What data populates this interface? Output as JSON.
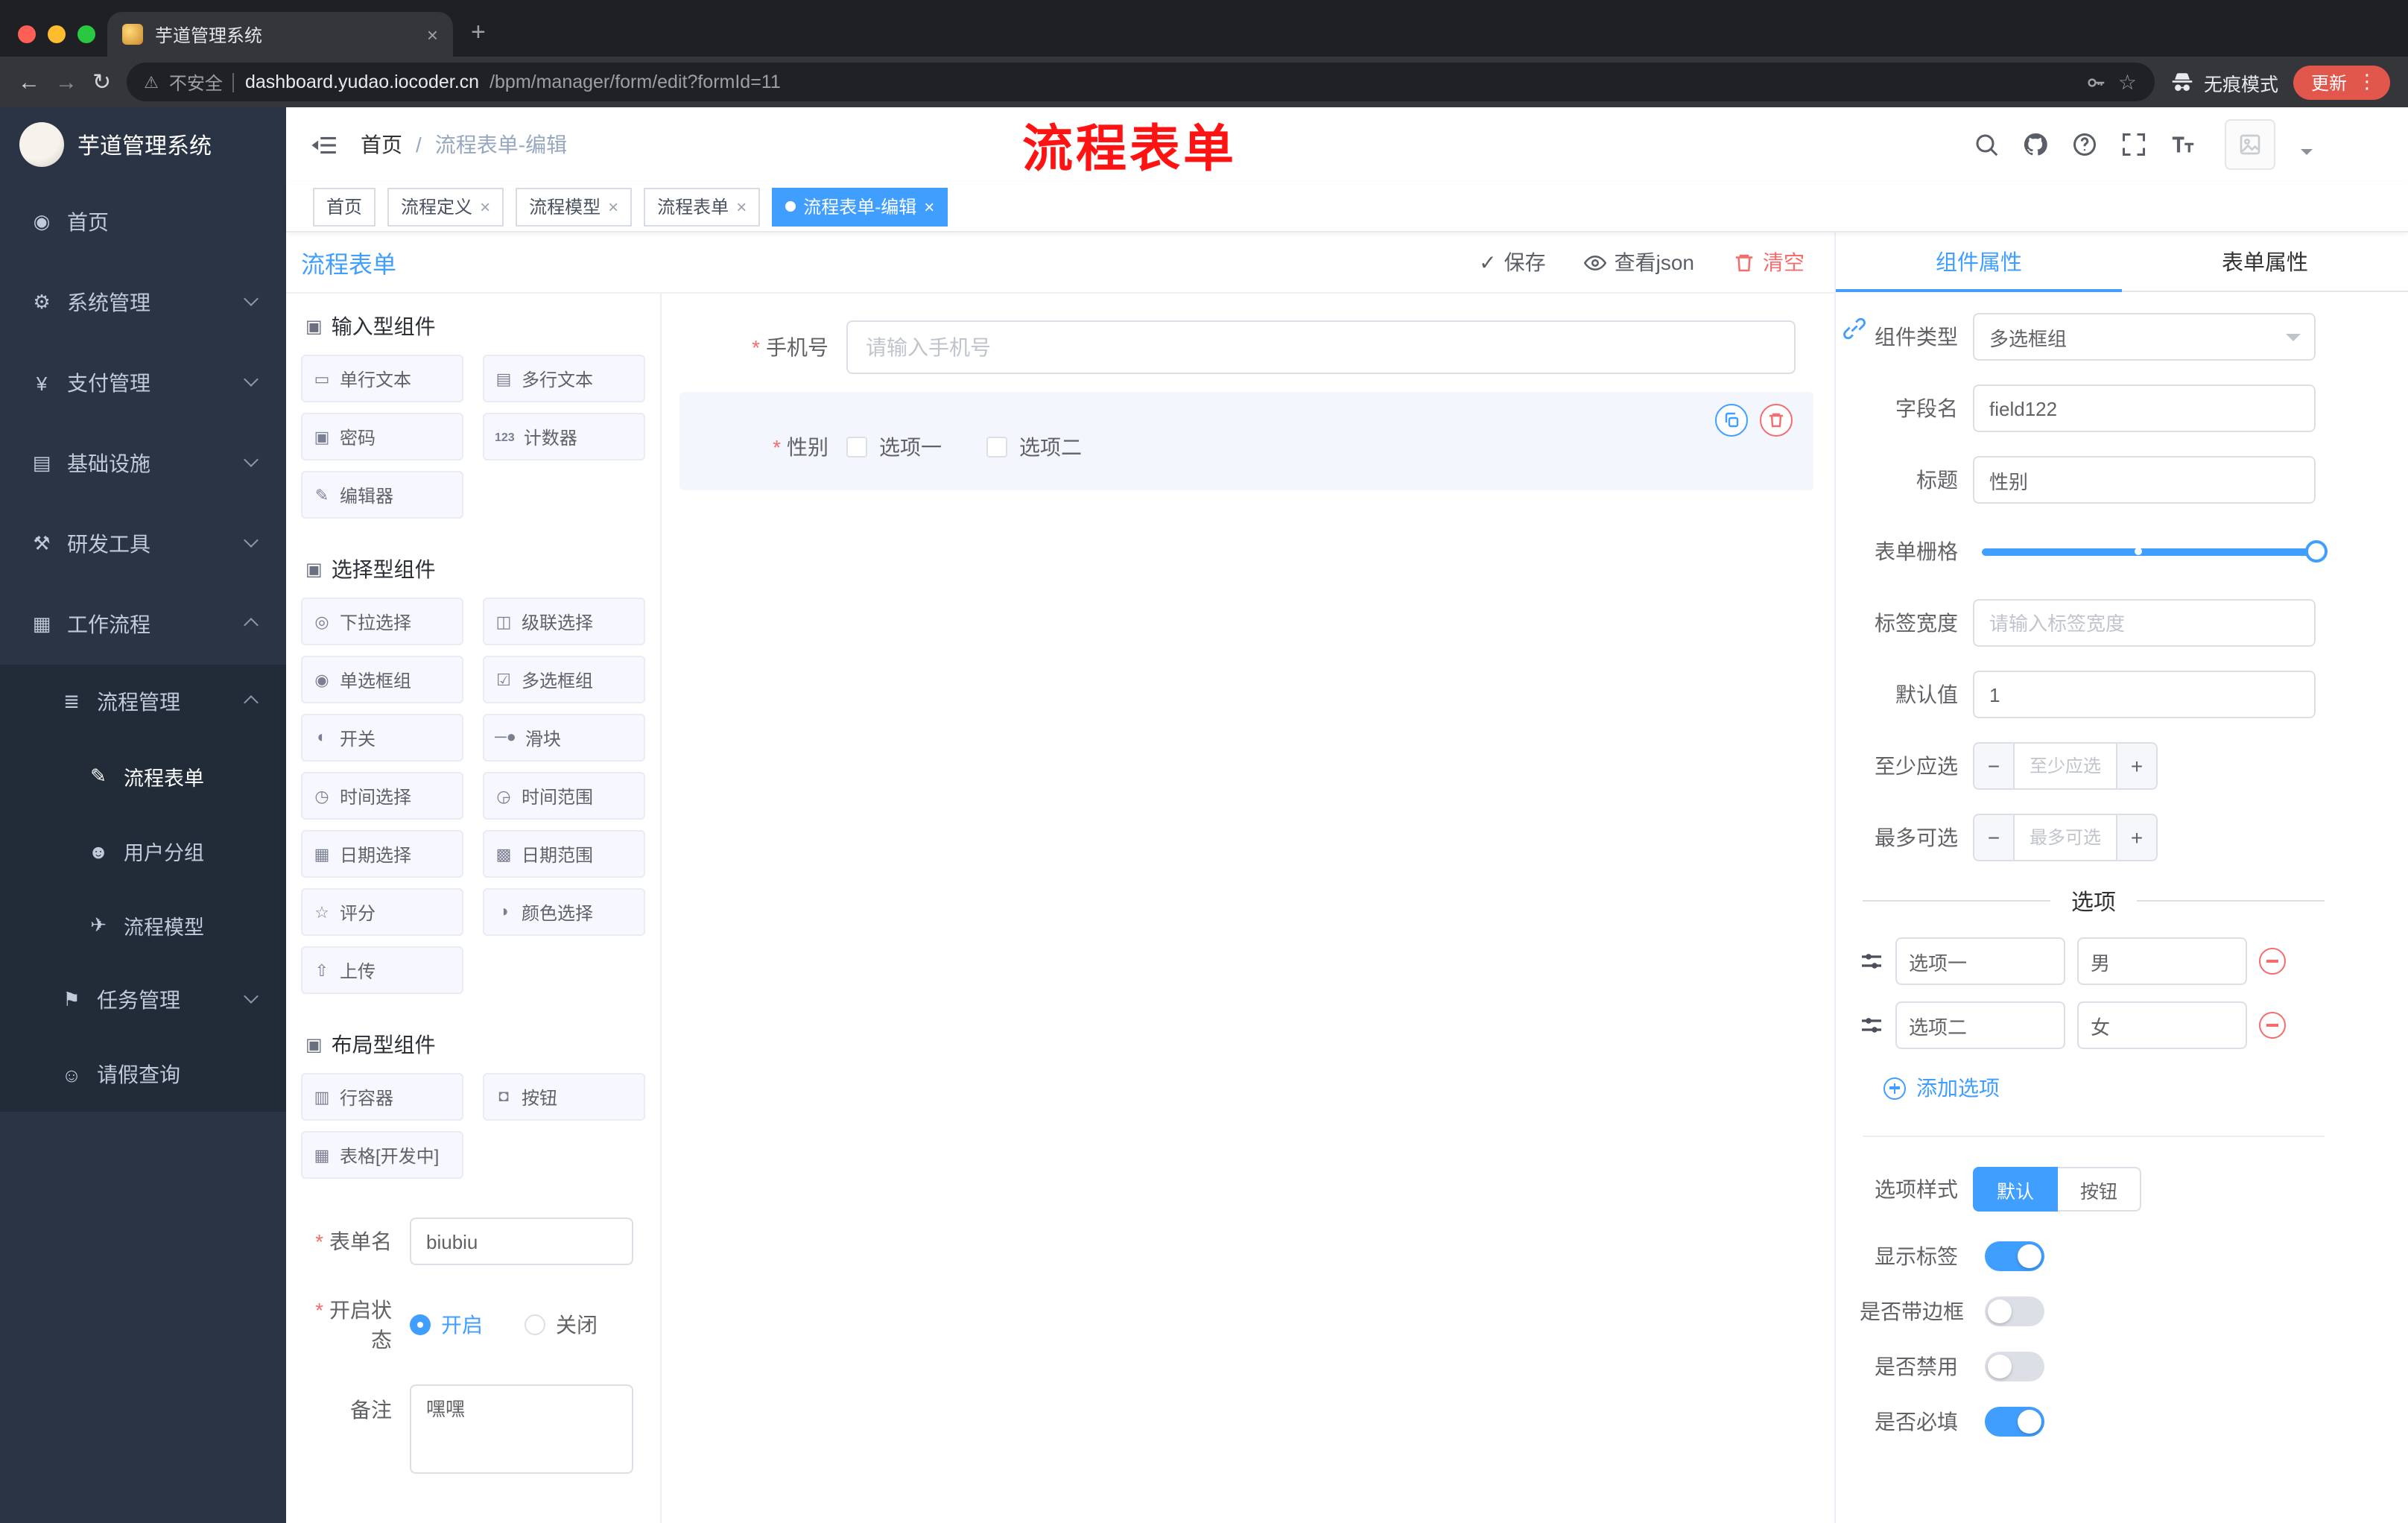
{
  "browser": {
    "tab_title": "芋道管理系统",
    "security_text": "不安全",
    "url_host": "dashboard.yudao.iocoder.cn",
    "url_path": "/bpm/manager/form/edit?formId=11",
    "incognito_label": "无痕模式",
    "update_label": "更新"
  },
  "icons": {
    "close": "×",
    "plus": "+",
    "back": "←",
    "forward": "→",
    "reload": "↻",
    "dots": "⋮",
    "warning": "⚠",
    "star": "☆",
    "check": "✓",
    "minus": "−",
    "plus_small": "+",
    "section": "▣"
  },
  "sidebar": {
    "logo_title": "芋道管理系统",
    "items": [
      {
        "icon": "◉",
        "label": "首页"
      },
      {
        "icon": "⚙",
        "label": "系统管理"
      },
      {
        "icon": "¥",
        "label": "支付管理"
      },
      {
        "icon": "▤",
        "label": "基础设施"
      },
      {
        "icon": "⚒",
        "label": "研发工具"
      },
      {
        "icon": "▦",
        "label": "工作流程"
      },
      {
        "icon": "≣",
        "label": "流程管理"
      },
      {
        "icon": "✎",
        "label": "流程表单"
      },
      {
        "icon": "☻",
        "label": "用户分组"
      },
      {
        "icon": "✈",
        "label": "流程模型"
      },
      {
        "icon": "⚑",
        "label": "任务管理"
      },
      {
        "icon": "☺",
        "label": "请假查询"
      }
    ]
  },
  "header": {
    "breadcrumb_home": "首页",
    "breadcrumb_sep": "/",
    "breadcrumb_current": "流程表单-编辑",
    "annotation": "流程表单"
  },
  "tags": {
    "items": [
      {
        "label": "首页"
      },
      {
        "label": "流程定义"
      },
      {
        "label": "流程模型"
      },
      {
        "label": "流程表单"
      },
      {
        "label": "流程表单-编辑"
      }
    ]
  },
  "designer": {
    "title": "流程表单",
    "actions": {
      "save": "保存",
      "view_json": "查看json",
      "clear": "清空"
    },
    "sections": [
      {
        "title": "输入型组件",
        "items": [
          {
            "icon": "▭",
            "label": "单行文本"
          },
          {
            "icon": "▤",
            "label": "多行文本"
          },
          {
            "icon": "▣",
            "label": "密码"
          },
          {
            "icon": "123",
            "label": "计数器"
          },
          {
            "icon": "✎",
            "label": "编辑器"
          }
        ]
      },
      {
        "title": "选择型组件",
        "items": [
          {
            "icon": "◎",
            "label": "下拉选择"
          },
          {
            "icon": "◫",
            "label": "级联选择"
          },
          {
            "icon": "◉",
            "label": "单选框组"
          },
          {
            "icon": "☑",
            "label": "多选框组"
          },
          {
            "icon": "◐",
            "label": "开关"
          },
          {
            "icon": "─●",
            "label": "滑块"
          },
          {
            "icon": "◷",
            "label": "时间选择"
          },
          {
            "icon": "◶",
            "label": "时间范围"
          },
          {
            "icon": "▦",
            "label": "日期选择"
          },
          {
            "icon": "▩",
            "label": "日期范围"
          },
          {
            "icon": "☆",
            "label": "评分"
          },
          {
            "icon": "◑",
            "label": "颜色选择"
          },
          {
            "icon": "⇧",
            "label": "上传"
          }
        ]
      },
      {
        "title": "布局型组件",
        "items": [
          {
            "icon": "▥",
            "label": "行容器"
          },
          {
            "icon": "◘",
            "label": "按钮"
          },
          {
            "icon": "▦",
            "label": "表格[开发中]"
          }
        ]
      }
    ],
    "meta": {
      "form_name_label": "表单名",
      "form_name_value": "biubiu",
      "status_label": "开启状态",
      "status_on": "开启",
      "status_off": "关闭",
      "remark_label": "备注",
      "remark_value": "嘿嘿"
    }
  },
  "canvas": {
    "phone_label": "手机号",
    "phone_placeholder": "请输入手机号",
    "gender_label": "性别",
    "gender_options": [
      "选项一",
      "选项二"
    ]
  },
  "props": {
    "tabs": [
      "组件属性",
      "表单属性"
    ],
    "rows": {
      "type_label": "组件类型",
      "type_value": "多选框组",
      "field_label": "字段名",
      "field_value": "field122",
      "title_label": "标题",
      "title_value": "性别",
      "grid_label": "表单栅格",
      "width_label": "标签宽度",
      "width_placeholder": "请输入标签宽度",
      "default_label": "默认值",
      "default_value": "1",
      "min_label": "至少应选",
      "min_placeholder": "至少应选",
      "max_label": "最多可选",
      "max_placeholder": "最多可选"
    },
    "options": {
      "divider_title": "选项",
      "rows": [
        {
          "label": "选项一",
          "value": "男"
        },
        {
          "label": "选项二",
          "value": "女"
        }
      ],
      "add_label": "添加选项"
    },
    "style": {
      "label": "选项样式",
      "opt_default": "默认",
      "opt_button": "按钮"
    },
    "switches": [
      {
        "label": "显示标签",
        "on": true
      },
      {
        "label": "是否带边框",
        "on": false
      },
      {
        "label": "是否禁用",
        "on": false
      },
      {
        "label": "是否必填",
        "on": true
      }
    ]
  },
  "colors": {
    "accent": "#409EFF",
    "danger": "#F56C6C",
    "annotation_red": "#FF1212",
    "sidebar_bg": "#2B3444",
    "submenu_bg": "#222B38",
    "active_tag": "#409EFF",
    "update_chip": "#E2574C",
    "selected_block_bg": "#F3F6FD"
  }
}
